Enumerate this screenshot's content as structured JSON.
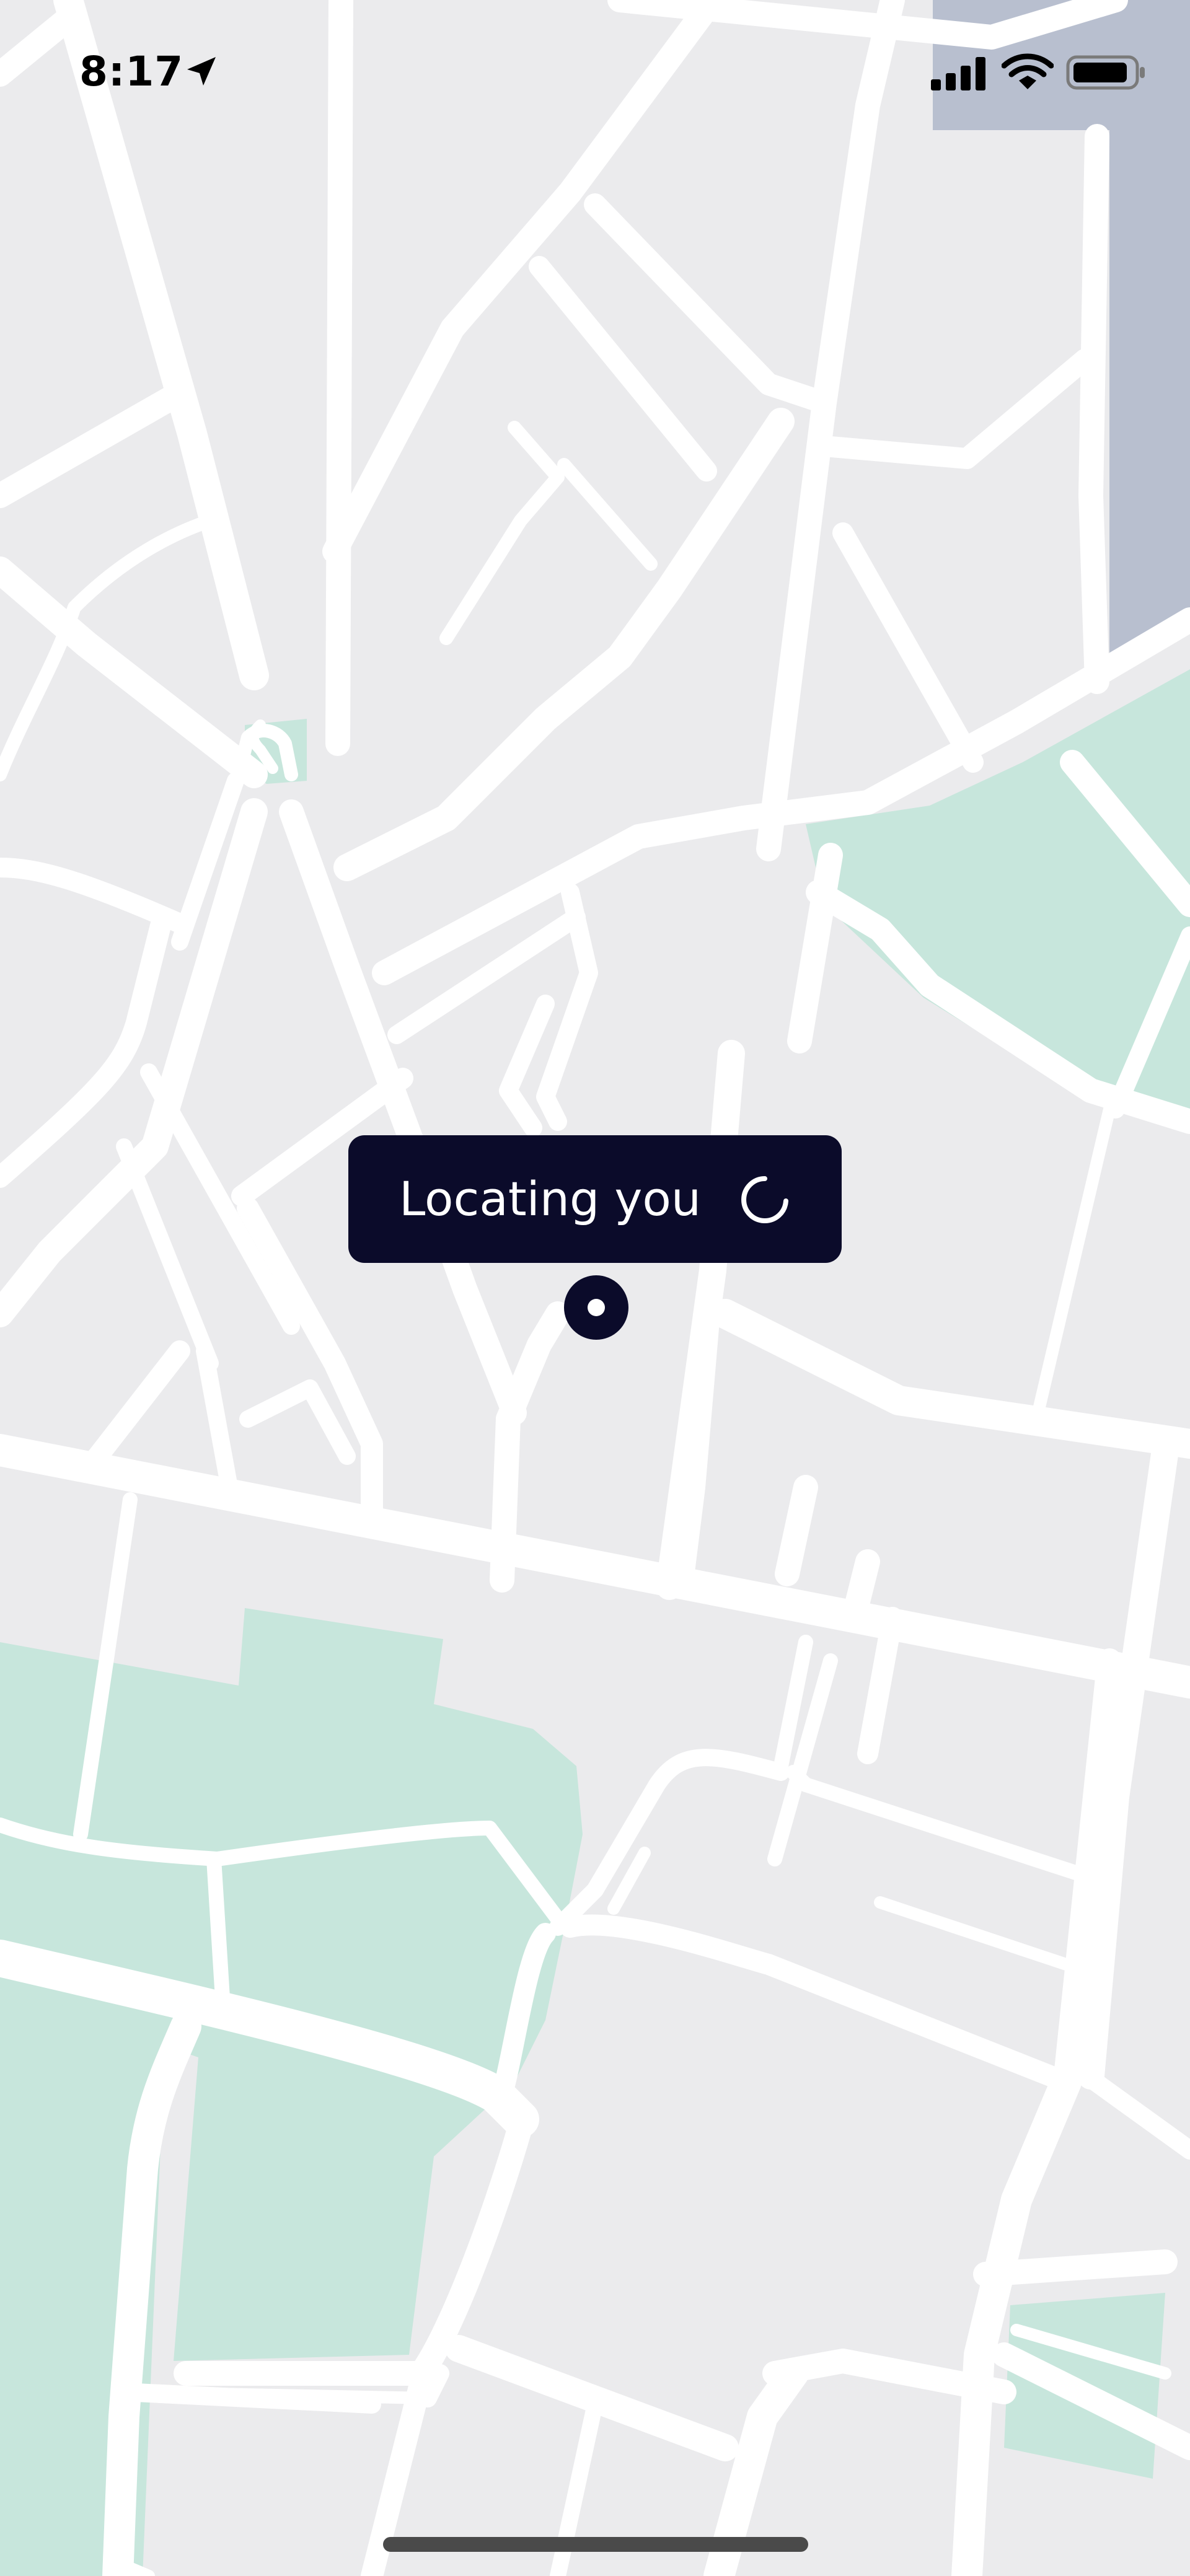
{
  "status_bar": {
    "time": "8:17",
    "location_icon": "location-arrow-icon",
    "signal_icon": "cellular-signal-icon",
    "wifi_icon": "wifi-icon",
    "battery_icon": "battery-icon"
  },
  "locating_banner": {
    "text": "Locating you",
    "spinner_icon": "loading-spinner-icon"
  },
  "map": {
    "background_color": "#ebebed",
    "road_color": "#ffffff",
    "park_color": "#c7e6dc",
    "water_color": "#b8bfcf"
  },
  "marker": {
    "icon": "user-location-marker",
    "color": "#0b0b2a"
  },
  "home_indicator": {
    "color": "#4a4a4a"
  }
}
